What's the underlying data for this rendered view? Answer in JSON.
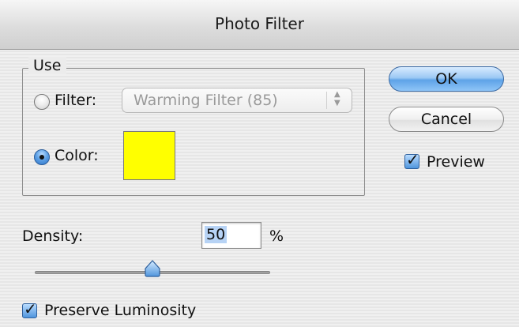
{
  "dialog": {
    "title": "Photo Filter"
  },
  "use_group": {
    "legend": "Use",
    "filter_label": "Filter:",
    "filter_selected": false,
    "filter_value": "Warming Filter (85)",
    "color_label": "Color:",
    "color_selected": true,
    "color_value": "#ffff00"
  },
  "buttons": {
    "ok": "OK",
    "cancel": "Cancel"
  },
  "preview": {
    "label": "Preview",
    "checked": true
  },
  "density": {
    "label": "Density:",
    "value": "50",
    "unit": "%",
    "slider_fraction": 0.5
  },
  "preserve_luminosity": {
    "label": "Preserve Luminosity",
    "checked": true
  },
  "icons": {
    "select_arrows": "up-down-arrows-icon",
    "checkmark": "checkmark-icon"
  }
}
